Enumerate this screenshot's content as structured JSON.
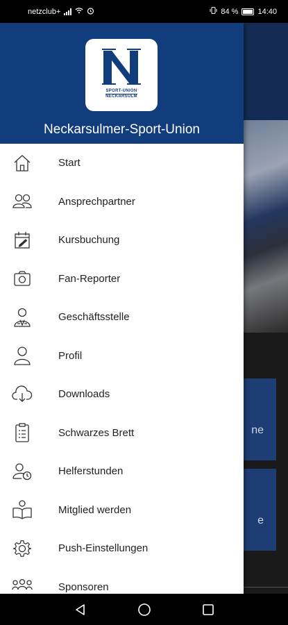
{
  "status_bar": {
    "carrier": "netzclub+",
    "battery": "84 %",
    "time": "14:40"
  },
  "background": {
    "tile1_text": "ne",
    "tile2_text": "e"
  },
  "drawer": {
    "title": "Neckarsulmer-Sport-Union",
    "logo": {
      "line1": "SPORT-UNION",
      "line2": "NECKARSULM"
    },
    "items": [
      {
        "label": "Start",
        "icon": "home-icon"
      },
      {
        "label": "Ansprechpartner",
        "icon": "contacts-icon"
      },
      {
        "label": "Kursbuchung",
        "icon": "calendar-edit-icon"
      },
      {
        "label": "Fan-Reporter",
        "icon": "camera-icon"
      },
      {
        "label": "Geschäftsstelle",
        "icon": "office-person-icon"
      },
      {
        "label": "Profil",
        "icon": "user-icon"
      },
      {
        "label": "Downloads",
        "icon": "cloud-download-icon"
      },
      {
        "label": "Schwarzes Brett",
        "icon": "clipboard-icon"
      },
      {
        "label": "Helferstunden",
        "icon": "user-clock-icon"
      },
      {
        "label": "Mitglied werden",
        "icon": "person-book-icon"
      },
      {
        "label": "Push-Einstellungen",
        "icon": "gear-icon"
      },
      {
        "label": "Sponsoren",
        "icon": "group-icon"
      }
    ]
  },
  "colors": {
    "brand_blue": "#123d7d",
    "header_bg_dark": "#132b55",
    "text": "#222222"
  }
}
